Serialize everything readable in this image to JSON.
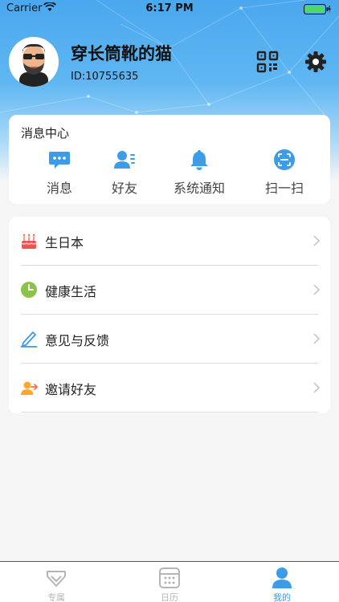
{
  "status_bar": {
    "carrier": "Carrier",
    "time": "6:17 PM"
  },
  "profile": {
    "name": "穿长筒靴的猫",
    "id": "ID:10755635"
  },
  "message_center": {
    "title": "消息中心",
    "items": [
      {
        "label": "消息",
        "icon": "chat-bubble-icon"
      },
      {
        "label": "好友",
        "icon": "friends-icon"
      },
      {
        "label": "系统通知",
        "icon": "bell-icon"
      },
      {
        "label": "扫一扫",
        "icon": "scan-icon"
      }
    ]
  },
  "menu": {
    "items": [
      {
        "label": "生日本",
        "icon": "birthday-cake-icon"
      },
      {
        "label": "健康生活",
        "icon": "clock-icon"
      },
      {
        "label": "意见与反馈",
        "icon": "pen-icon"
      },
      {
        "label": "邀请好友",
        "icon": "invite-friend-icon"
      }
    ]
  },
  "tab_bar": {
    "tabs": [
      {
        "label": "专属",
        "icon": "diamond-icon",
        "active": false
      },
      {
        "label": "日历",
        "icon": "calendar-icon",
        "active": false
      },
      {
        "label": "我的",
        "icon": "person-icon",
        "active": true
      }
    ],
    "active_color": "#3d9ce8",
    "inactive_color": "#b5b5b5"
  },
  "colors": {
    "header_blue": "#4aa8ee",
    "accent_blue": "#3d9ce8"
  }
}
